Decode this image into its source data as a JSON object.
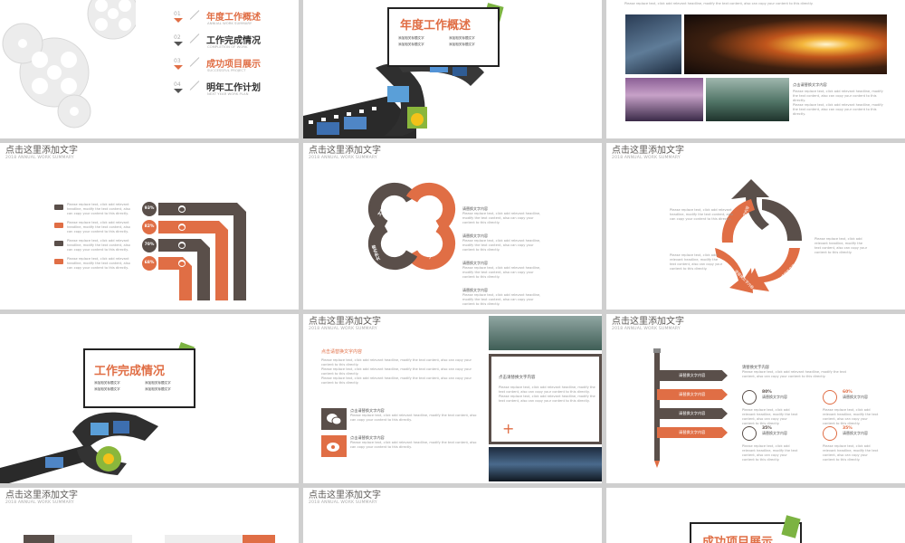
{
  "slide_header": {
    "title": "点击这里添加文字",
    "subtitle": "2018 ANNUAL WORK SUMMARY"
  },
  "toc": [
    {
      "num": "01",
      "title": "年度工作概述",
      "sub": "ANNUAL WORK SUMMARY",
      "active": true
    },
    {
      "num": "02",
      "title": "工作完成情况",
      "sub": "COMPLETION OF WORK",
      "active": false
    },
    {
      "num": "03",
      "title": "成功项目展示",
      "sub": "SUCCESSFUL PROJECT",
      "active": true
    },
    {
      "num": "04",
      "title": "明年工作计划",
      "sub": "NEXT YEAR WORK PLAN",
      "active": false
    }
  ],
  "section1": {
    "title": "年度工作概述",
    "bullets": [
      "添加相关标题文字",
      "添加相关标题文字",
      "添加相关标题文字",
      "添加相关标题文字"
    ]
  },
  "section2": {
    "title": "工作完成情况",
    "bullets": [
      "添加相关标题文字",
      "添加相关标题文字",
      "添加相关标题文字",
      "添加相关标题文字"
    ]
  },
  "section3": {
    "title": "成功项目展示"
  },
  "photo_slide": {
    "caption": "点击请替换文字内容"
  },
  "percent_slide": {
    "values": [
      "93%",
      "82%",
      "70%",
      "68%"
    ],
    "icons": [
      "power-icon",
      "megaphone-icon",
      "umbrella-icon",
      "chart-icon"
    ]
  },
  "knot_slide": {
    "labels": [
      "文字内容",
      "文字内容",
      "文字内容",
      "文字内容"
    ],
    "items": [
      "请替换文字内容",
      "请替换文字内容",
      "请替换文字内容",
      "请替换文字内容"
    ]
  },
  "cycle_slide": {
    "labels": [
      "请替换文字内容",
      "请替换文字内容",
      "请替换文字内容"
    ]
  },
  "wechat_slide": {
    "heading": "点击请替换文字内容",
    "box_title": "点击请替换文字内容",
    "item1": "点击请替换文字内容",
    "item2": "点击请替换文字内容"
  },
  "pencil_slide": {
    "steps": [
      "请替换文字内容",
      "请替换文字内容",
      "请替换文字内容",
      "请替换文字内容"
    ],
    "heading": "请替换文字内容",
    "stats": [
      {
        "value": "80%",
        "label": "请替换文字内容"
      },
      {
        "value": "60%",
        "label": "请替换文字内容"
      },
      {
        "value": "35%",
        "label": "请替换文字内容"
      },
      {
        "value": "35%",
        "label": "请替换文字内容"
      }
    ]
  },
  "lorem": "Please replace text, click add relevant headline, modify the text content, also can copy your content to this directly."
}
